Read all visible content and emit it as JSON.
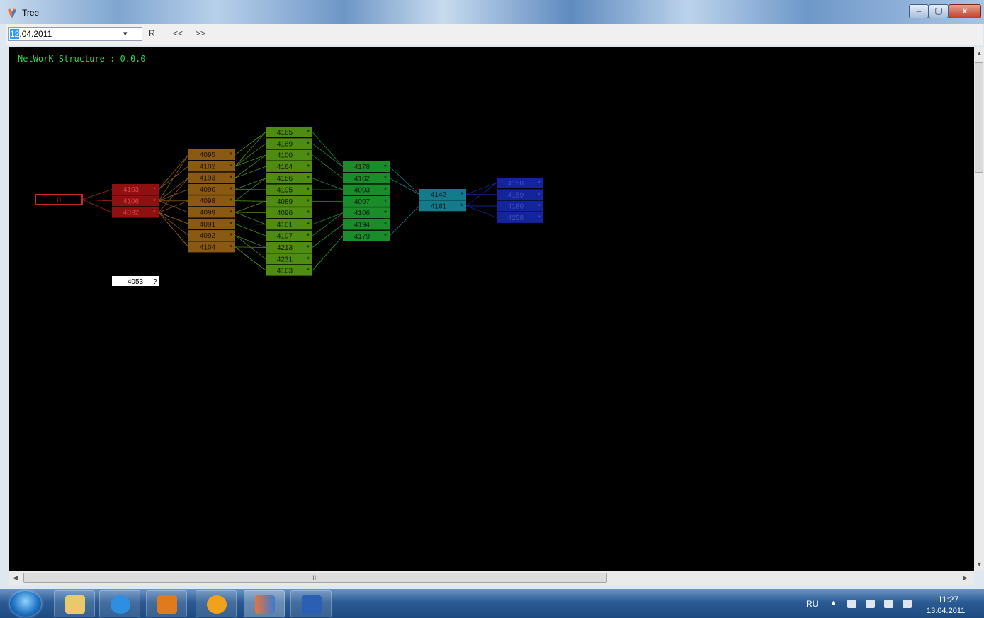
{
  "window": {
    "title": "Tree",
    "icon": "tree-app-icon",
    "min_glyph": "–",
    "max_glyph": "▢",
    "close_glyph": "x"
  },
  "toolbar": {
    "date_selected": "12",
    "date_rest": ".04.2011",
    "calendar_glyph": "▾",
    "refresh_label": "R",
    "prev_label": "<<",
    "next_label": ">>"
  },
  "canvas": {
    "title": "NetWorK Structure  : 0.0.0",
    "root": {
      "label": "0",
      "color": "#c8282d"
    },
    "levels": [
      {
        "color": "#8e1111",
        "text_color": "#e04040",
        "items": [
          "4103",
          "4106",
          "4032"
        ]
      },
      {
        "color": "#8a5a12",
        "text_color": "#1a1100",
        "items": [
          "4095",
          "4102",
          "4193",
          "4090",
          "4098",
          "4099",
          "4091",
          "4092",
          "4104"
        ]
      },
      {
        "color": "#4f8c12",
        "text_color": "#0a1a00",
        "items": [
          "4165",
          "4169",
          "4100",
          "4164",
          "4166",
          "4195",
          "4089",
          "4096",
          "4101",
          "4197",
          "4213",
          "4231",
          "4163"
        ]
      },
      {
        "color": "#1b8c2a",
        "text_color": "#052010",
        "items": [
          "4178",
          "4162",
          "4093",
          "4097",
          "4106",
          "4194",
          "4179"
        ]
      },
      {
        "color": "#137c8c",
        "text_color": "#021a20",
        "items": [
          "4142",
          "4161"
        ]
      },
      {
        "color": "#14249a",
        "text_color": "#3c50c8",
        "items": [
          "4158",
          "4159",
          "4180",
          "4258"
        ]
      }
    ],
    "marker": "*",
    "orphan": {
      "label": "4053",
      "marker": "?"
    }
  },
  "scroll": {
    "h_grip": "III"
  },
  "taskbar": {
    "apps": [
      "explorer-icon",
      "ie-icon",
      "media-player-icon",
      "tree-app-icon",
      "word-icon"
    ],
    "tray": {
      "lang": "RU",
      "time": "11:27",
      "date": "13.04.2011"
    }
  }
}
